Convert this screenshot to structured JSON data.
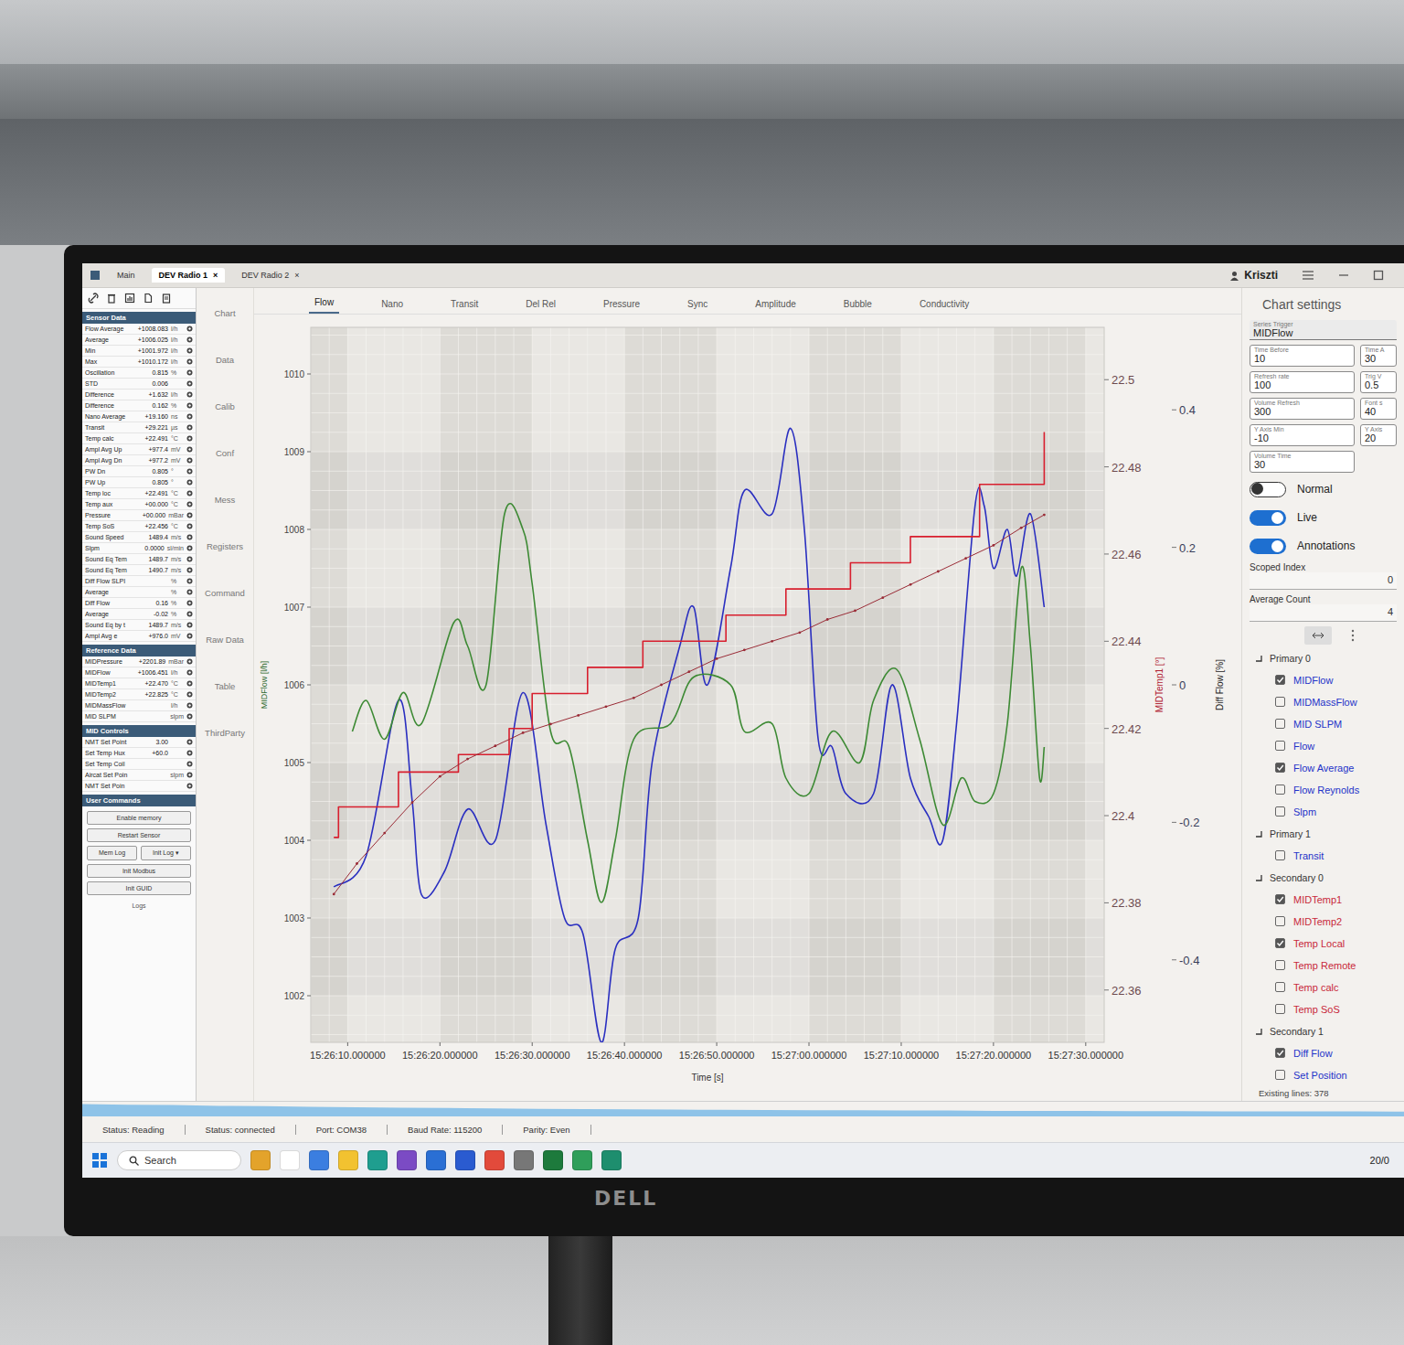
{
  "app": {
    "tabs": [
      {
        "label": "Main",
        "selected": false,
        "close": ""
      },
      {
        "label": "DEV Radio 1",
        "selected": true,
        "close": "×"
      },
      {
        "label": "DEV Radio 2",
        "selected": false,
        "close": "×"
      }
    ],
    "user": "Kriszti"
  },
  "sidebar": {
    "sections": [
      {
        "title": "Sensor Data",
        "rows": [
          {
            "label": "Flow Average",
            "value": "+1008.083",
            "unit": "l/h"
          },
          {
            "label": "Average",
            "value": "+1006.025",
            "unit": "l/h"
          },
          {
            "label": "Min",
            "value": "+1001.972",
            "unit": "l/h"
          },
          {
            "label": "Max",
            "value": "+1010.172",
            "unit": "l/h"
          },
          {
            "label": "Oscillation",
            "value": "0.815",
            "unit": "%"
          },
          {
            "label": "STD",
            "value": "0.006",
            "unit": ""
          },
          {
            "label": "Difference",
            "value": "+1.632",
            "unit": "l/h"
          },
          {
            "label": "Difference",
            "value": "0.162",
            "unit": "%"
          },
          {
            "label": "Nano Average",
            "value": "+19.160",
            "unit": "ns"
          },
          {
            "label": "Transit",
            "value": "+29.221",
            "unit": "µs"
          },
          {
            "label": "Temp calc",
            "value": "+22.491",
            "unit": "°C"
          },
          {
            "label": "Ampl Avg Up",
            "value": "+977.4",
            "unit": "mV"
          },
          {
            "label": "Ampl Avg Dn",
            "value": "+977.2",
            "unit": "mV"
          },
          {
            "label": "PW Dn",
            "value": "0.805",
            "unit": "°"
          },
          {
            "label": "PW Up",
            "value": "0.805",
            "unit": "°"
          },
          {
            "label": "Temp loc",
            "value": "+22.491",
            "unit": "°C"
          },
          {
            "label": "Temp aux",
            "value": "+00.000",
            "unit": "°C"
          },
          {
            "label": "Pressure",
            "value": "+00.000",
            "unit": "mBar"
          },
          {
            "label": "Temp SoS",
            "value": "+22.456",
            "unit": "°C"
          },
          {
            "label": "Sound Speed",
            "value": "1489.4",
            "unit": "m/s"
          },
          {
            "label": "Slpm",
            "value": "0.0000",
            "unit": "sl/min"
          },
          {
            "label": "Sound Eq Tem",
            "value": "1489.7",
            "unit": "m/s"
          },
          {
            "label": "Sound Eq Tem",
            "value": "1490.7",
            "unit": "m/s"
          },
          {
            "label": "Diff Flow SLPI",
            "value": "",
            "unit": "%"
          },
          {
            "label": "Average",
            "value": "",
            "unit": "%"
          },
          {
            "label": "Diff Flow",
            "value": "0.16",
            "unit": "%"
          },
          {
            "label": "Average",
            "value": "-0.02",
            "unit": "%"
          },
          {
            "label": "Sound Eq by t",
            "value": "1489.7",
            "unit": "m/s"
          },
          {
            "label": "Ampl Avg e",
            "value": "+976.0",
            "unit": "mV"
          }
        ]
      },
      {
        "title": "Reference Data",
        "rows": [
          {
            "label": "MIDPressure",
            "value": "+2201.89",
            "unit": "mBar"
          },
          {
            "label": "MIDFlow",
            "value": "+1006.451",
            "unit": "l/h"
          },
          {
            "label": "MIDTemp1",
            "value": "+22.470",
            "unit": "°C"
          },
          {
            "label": "MIDTemp2",
            "value": "+22.825",
            "unit": "°C"
          },
          {
            "label": "MIDMassFlow",
            "value": "",
            "unit": "l/h"
          },
          {
            "label": "MID SLPM",
            "value": "",
            "unit": "slpm"
          }
        ]
      },
      {
        "title": "MID Controls",
        "rows": [
          {
            "label": "NMT Set Point",
            "value": "3.00",
            "unit": ""
          },
          {
            "label": "Set Temp Hux",
            "value": "+60.0",
            "unit": ""
          },
          {
            "label": "Set Temp Coil",
            "value": "",
            "unit": ""
          },
          {
            "label": "Aircat Set Poin",
            "value": "",
            "unit": "slpm"
          },
          {
            "label": "NMT Set Poin",
            "value": "",
            "unit": ""
          }
        ]
      }
    ],
    "commands": {
      "title": "User Commands",
      "buttons": [
        {
          "label": "Enable memory",
          "kind": "full"
        },
        {
          "label": "Restart Sensor",
          "kind": "full"
        },
        {
          "label": "Mem Log",
          "kind": "half"
        },
        {
          "label": "Init Log ▾",
          "kind": "half"
        },
        {
          "label": "Init Modbus",
          "kind": "full"
        },
        {
          "label": "Init GUID",
          "kind": "full"
        }
      ],
      "footer": "Logs"
    }
  },
  "nav": [
    "Chart",
    "Data",
    "Calib",
    "Conf",
    "Mess",
    "Registers",
    "Command",
    "Raw Data",
    "Table",
    "ThirdParty"
  ],
  "chart_tabs": [
    {
      "label": "Flow",
      "selected": true
    },
    {
      "label": "Nano",
      "selected": false
    },
    {
      "label": "Transit",
      "selected": false
    },
    {
      "label": "Del Rel",
      "selected": false
    },
    {
      "label": "Pressure",
      "selected": false
    },
    {
      "label": "Sync",
      "selected": false
    },
    {
      "label": "Amplitude",
      "selected": false
    },
    {
      "label": "Bubble",
      "selected": false
    },
    {
      "label": "Conductivity",
      "selected": false
    }
  ],
  "chart": {
    "y_left": {
      "title": "MIDFlow [l/h]",
      "ticks": [
        "1002",
        "1003",
        "1004",
        "1005",
        "1006",
        "1007",
        "1008",
        "1009",
        "1010"
      ]
    },
    "y_temp": {
      "title": "MIDTemp1 [°]",
      "ticks": [
        "22.36",
        "22.38",
        "22.4",
        "22.42",
        "22.44",
        "22.46",
        "22.48",
        "22.5"
      ]
    },
    "y_diff": {
      "title": "Diff Flow [%]",
      "ticks": [
        "-0.4",
        "-0.2",
        "0",
        "0.2",
        "0.4"
      ]
    },
    "x": {
      "title": "Time [s]",
      "ticks": [
        {
          "label": "15:26:10.000000",
          "t": 10
        },
        {
          "label": "15:26:20.000000",
          "t": 20
        },
        {
          "label": "15:26:30.000000",
          "t": 30
        },
        {
          "label": "15:26:40.000000",
          "t": 40
        },
        {
          "label": "15:26:50.000000",
          "t": 50
        },
        {
          "label": "15:27:00.000000",
          "t": 60
        },
        {
          "label": "15:27:10.000000",
          "t": 70
        },
        {
          "label": "15:27:20.000000",
          "t": 80
        },
        {
          "label": "15:27:30.000000",
          "t": 90
        }
      ]
    },
    "series": [
      {
        "color": "#2a2fc0",
        "axis": "left",
        "kind": "curve",
        "t": [
          8.5,
          12,
          15.5,
          17,
          18,
          20.5,
          23,
          26,
          29,
          31.5,
          33.5,
          35.5,
          37.5,
          39,
          41.5,
          43,
          46,
          47.5,
          49,
          51.5,
          53,
          56,
          58,
          59.5,
          61,
          62.5,
          64,
          67,
          69,
          71,
          73,
          74.5,
          76,
          78,
          79,
          80,
          81.5,
          82.5,
          84,
          85.5
        ],
        "values": [
          1003.4,
          1003.8,
          1005.8,
          1004.5,
          1003.3,
          1003.6,
          1004.4,
          1004.0,
          1005.9,
          1004.2,
          1003.0,
          1002.8,
          1001.4,
          1002.6,
          1003.0,
          1005.0,
          1006.5,
          1007.0,
          1006.0,
          1007.5,
          1008.5,
          1008.2,
          1009.3,
          1008.0,
          1005.3,
          1005.2,
          1004.6,
          1004.6,
          1006.0,
          1004.8,
          1004.3,
          1004.0,
          1005.5,
          1008.3,
          1008.3,
          1007.5,
          1008.0,
          1007.4,
          1008.2,
          1007.0
        ]
      },
      {
        "color": "#3d8a34",
        "axis": "left",
        "kind": "curve",
        "t": [
          10.5,
          12,
          14,
          16,
          18,
          21.5,
          23,
          25,
          27,
          29,
          30,
          32,
          34,
          36,
          37.5,
          39,
          41,
          45,
          47.5,
          51.5,
          53,
          56,
          57.5,
          60,
          62.5,
          65.5,
          67,
          69.5,
          72,
          74.5,
          76.5,
          78,
          80,
          81.5,
          83,
          84,
          85,
          85.5
        ],
        "values": [
          1005.4,
          1005.8,
          1005.3,
          1005.9,
          1005.5,
          1006.8,
          1006.5,
          1006.0,
          1008.2,
          1008.0,
          1007.3,
          1005.4,
          1005.2,
          1004.0,
          1003.2,
          1004.0,
          1005.3,
          1005.5,
          1006.1,
          1006.0,
          1005.4,
          1005.5,
          1004.8,
          1004.6,
          1005.4,
          1005.0,
          1005.8,
          1006.2,
          1005.3,
          1004.2,
          1004.8,
          1004.5,
          1004.6,
          1005.5,
          1007.5,
          1006.5,
          1004.8,
          1005.2
        ]
      },
      {
        "color": "#d81f2e",
        "axis": "temp",
        "kind": "step",
        "t": [
          8.5,
          9,
          15.5,
          22,
          27.5,
          30,
          36,
          42,
          51,
          57.5,
          64.5,
          71,
          78.5,
          85.5
        ],
        "values": [
          22.395,
          22.402,
          22.41,
          22.414,
          22.42,
          22.428,
          22.434,
          22.44,
          22.446,
          22.452,
          22.458,
          22.464,
          22.476,
          22.488
        ]
      },
      {
        "color": "#9a2b36",
        "axis": "temp",
        "kind": "markers",
        "t": [
          8.5,
          11,
          14,
          17,
          20,
          23,
          26,
          29,
          32,
          35,
          38,
          41,
          44,
          47,
          50,
          53,
          56,
          59,
          62,
          65,
          68,
          71,
          74,
          77,
          80,
          83,
          85.5
        ],
        "values": [
          22.382,
          22.389,
          22.396,
          22.403,
          22.409,
          22.413,
          22.416,
          22.419,
          22.421,
          22.423,
          22.425,
          22.427,
          22.43,
          22.433,
          22.436,
          22.438,
          22.44,
          22.442,
          22.445,
          22.447,
          22.45,
          22.453,
          22.456,
          22.459,
          22.462,
          22.466,
          22.469
        ]
      }
    ]
  },
  "settings": {
    "title": "Chart settings",
    "series_trigger": {
      "label": "Series Trigger",
      "value": "MIDFlow"
    },
    "fields": [
      {
        "label": "Time Before",
        "value": "10"
      },
      {
        "label": "Time A",
        "value": "30"
      },
      {
        "label": "Refresh rate",
        "value": "100"
      },
      {
        "label": "Trig V",
        "value": "0.5"
      },
      {
        "label": "Volume Refresh",
        "value": "300"
      },
      {
        "label": "Font s",
        "value": "40"
      },
      {
        "label": "Y Axis Min",
        "value": "-10"
      },
      {
        "label": "Y Axis",
        "value": "20"
      },
      {
        "label": "Volume Time",
        "value": "30"
      }
    ],
    "toggles": [
      {
        "label": "Normal",
        "on": false
      },
      {
        "label": "Live",
        "on": true
      },
      {
        "label": "Annotations",
        "on": true
      }
    ],
    "scoped_index": {
      "label": "Scoped Index",
      "value": "0"
    },
    "average_count": {
      "label": "Average Count",
      "value": "4"
    },
    "groups": [
      {
        "label": "Primary 0",
        "expanded": true,
        "color": "#2433c9",
        "items": [
          {
            "label": "MIDFlow",
            "checked": true
          },
          {
            "label": "MIDMassFlow",
            "checked": false
          },
          {
            "label": "MID SLPM",
            "checked": false
          },
          {
            "label": "Flow",
            "checked": false
          },
          {
            "label": "Flow Average",
            "checked": true
          },
          {
            "label": "Flow Reynolds",
            "checked": false
          },
          {
            "label": "Slpm",
            "checked": false
          }
        ]
      },
      {
        "label": "Primary 1",
        "expanded": true,
        "color": "#2433c9",
        "items": [
          {
            "label": "Transit",
            "checked": false
          }
        ]
      },
      {
        "label": "Secondary 0",
        "expanded": true,
        "color": "#c8283a",
        "items": [
          {
            "label": "MIDTemp1",
            "checked": true
          },
          {
            "label": "MIDTemp2",
            "checked": false
          },
          {
            "label": "Temp Local",
            "checked": true
          },
          {
            "label": "Temp Remote",
            "checked": false
          },
          {
            "label": "Temp calc",
            "checked": false
          },
          {
            "label": "Temp SoS",
            "checked": false
          }
        ]
      },
      {
        "label": "Secondary 1",
        "expanded": true,
        "color": "#2433c9",
        "items": [
          {
            "label": "Diff Flow",
            "checked": true
          },
          {
            "label": "Set Position",
            "checked": false
          }
        ]
      }
    ],
    "existing_lines": "Existing lines: 378"
  },
  "status_bar": {
    "items": [
      "Status: Reading",
      "Status: connected",
      "Port: COM38",
      "Baud Rate: 115200",
      "Parity: Even"
    ],
    "volume": [
      0.85,
      0.8,
      0.78,
      0.72,
      0.7,
      0.66,
      0.62,
      0.6,
      0.58,
      0.55,
      0.52,
      0.5,
      0.48,
      0.47,
      0.45,
      0.44,
      0.42,
      0.42,
      0.4,
      0.4,
      0.38,
      0.38,
      0.37,
      0.36,
      0.36,
      0.35,
      0.35,
      0.34,
      0.34,
      0.33
    ]
  },
  "taskbar": {
    "search": "Search",
    "clock": "20/0"
  },
  "monitor": {
    "brand": "DELL"
  }
}
